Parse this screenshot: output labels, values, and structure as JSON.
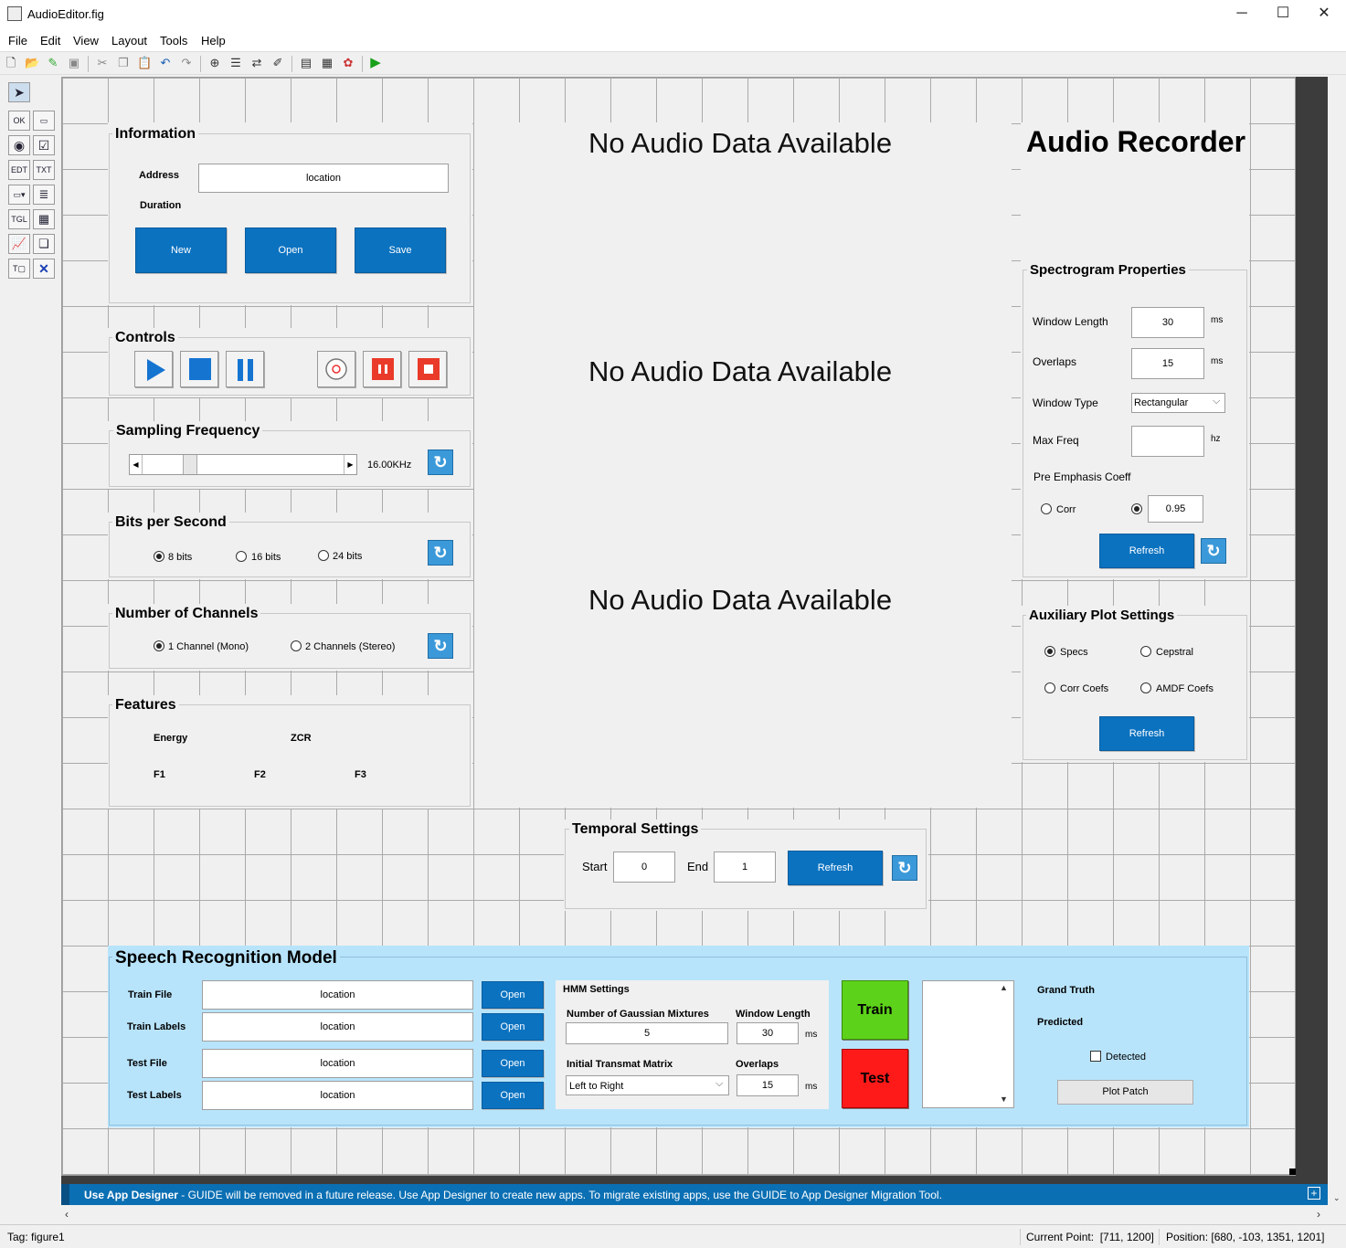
{
  "window": {
    "title": "AudioEditor.fig",
    "min": "─",
    "max": "☐",
    "close": "✕"
  },
  "menu": [
    "File",
    "Edit",
    "View",
    "Layout",
    "Tools",
    "Help"
  ],
  "information": {
    "title": "Information",
    "address_label": "Address",
    "address_value": "location",
    "duration_label": "Duration",
    "new": "New",
    "open": "Open",
    "save": "Save"
  },
  "controls": {
    "title": "Controls"
  },
  "sampling": {
    "title": "Sampling Frequency",
    "value": "16.00KHz",
    "refresh": "↻"
  },
  "bits": {
    "title": "Bits per Second",
    "options": [
      "8 bits",
      "16 bits",
      "24 bits"
    ],
    "selected": 0
  },
  "channels": {
    "title": "Number of Channels",
    "options": [
      "1 Channel (Mono)",
      "2 Channels (Stereo)"
    ],
    "selected": 0
  },
  "features": {
    "title": "Features",
    "energy": "Energy",
    "zcr": "ZCR",
    "f1": "F1",
    "f2": "F2",
    "f3": "F3"
  },
  "plots": {
    "p1": "No Audio Data Available",
    "p2": "No Audio Data Available",
    "p3": "No Audio Data Available"
  },
  "recorder_title": "Audio Recorder",
  "spectrogram": {
    "title": "Spectrogram Properties",
    "window_length_label": "Window Length",
    "window_length": "30",
    "ms1": "ms",
    "overlaps_label": "Overlaps",
    "overlaps": "15",
    "ms2": "ms",
    "window_type_label": "Window Type",
    "window_type": "Rectangular",
    "max_freq_label": "Max Freq",
    "max_freq": "",
    "hz": "hz",
    "pre_emph_label": "Pre Emphasis Coeff",
    "corr": "Corr",
    "coeff": "0.95",
    "refresh": "Refresh"
  },
  "auxiliary": {
    "title": "Auxiliary Plot Settings",
    "specs": "Specs",
    "cepstral": "Cepstral",
    "corr_coefs": "Corr Coefs",
    "amdf": "AMDF Coefs",
    "refresh": "Refresh"
  },
  "temporal": {
    "title": "Temporal Settings",
    "start_label": "Start",
    "start": "0",
    "end_label": "End",
    "end": "1",
    "refresh": "Refresh"
  },
  "speech": {
    "title": "Speech Recognition Model",
    "train_file": "Train File",
    "train_labels": "Train Labels",
    "test_file": "Test File",
    "test_labels": "Test Labels",
    "loc": "location",
    "open": "Open",
    "hmm_title": "HMM Settings",
    "gauss_label": "Number of Gaussian Mixtures",
    "gauss": "5",
    "wl_label": "Window Length",
    "wl": "30",
    "ms": "ms",
    "trans_label": "Initial Transmat Matrix",
    "trans": "Left to Right",
    "ov_label": "Overlaps",
    "ov": "15",
    "train": "Train",
    "test": "Test",
    "grand_truth": "Grand Truth",
    "predicted": "Predicted",
    "detected": "Detected",
    "plot_patch": "Plot Patch"
  },
  "appbar": {
    "bold": "Use App Designer",
    "text": " - GUIDE will be removed in a future release. Use App Designer to create new apps. To migrate existing apps, use the GUIDE to App Designer Migration Tool."
  },
  "status": {
    "tag": "Tag: figure1",
    "current_point": "Current Point:  [711, 1200]",
    "position": "Position: [680, -103, 1351, 1201]"
  },
  "colors": {
    "blue_button": "#0b72c0",
    "train": "#5dd21a",
    "test": "#ff1a1a",
    "speech_bg": "#b8e4fb",
    "appbar": "#0b6fb3"
  }
}
